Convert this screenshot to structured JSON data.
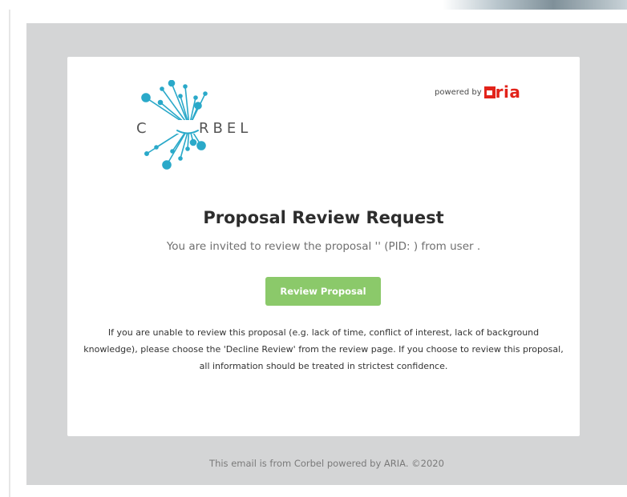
{
  "email": {
    "logo_text": "CORBEL",
    "powered_label": "powered by",
    "powered_brand": "aria",
    "title": "Proposal Review Request",
    "subtitle": "You are invited to review the proposal '' (PID: ) from user .",
    "button_label": "Review Proposal",
    "body": "If you are unable to review this proposal (e.g. lack of time, conflict of interest, lack of background knowledge), please choose the 'Decline Review' from the review page. If you choose to review this proposal, all information should be treated in strictest confidence.",
    "footer": "This email is from Corbel powered by ARIA. ©2020"
  },
  "colors": {
    "logo": "#2aa9c9",
    "button": "#8bc96a",
    "aria_red": "#e2231a",
    "outer_background": "#d4d5d6"
  }
}
